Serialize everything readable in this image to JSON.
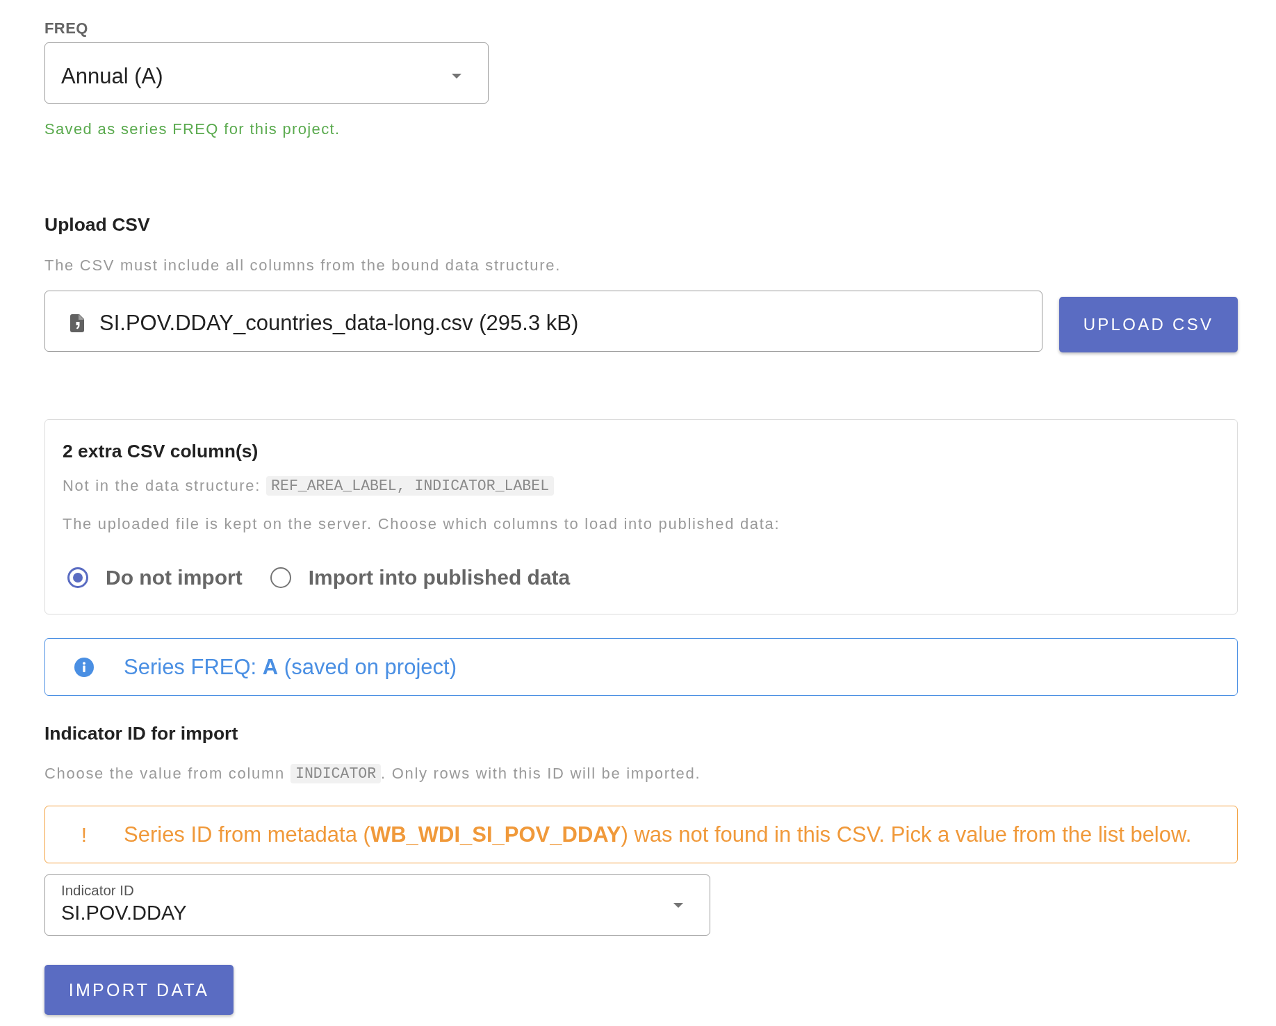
{
  "freq_field": {
    "label": "FREQ",
    "value": "Annual (A)",
    "helper": "Saved as series FREQ for this project."
  },
  "upload_csv": {
    "heading": "Upload CSV",
    "description": "The CSV must include all columns from the bound data structure.",
    "file": "SI.POV.DDAY_countries_data-long.csv (295.3 kB)",
    "button": "UPLOAD CSV"
  },
  "extra_columns": {
    "heading": "2 extra CSV column(s)",
    "missing_label": "Not in the data structure:",
    "missing_columns": "REF_AREA_LABEL, INDICATOR_LABEL",
    "note": "The uploaded file is kept on the server. Choose which columns to load into published data:",
    "options": [
      {
        "label": "Do not import",
        "selected": true
      },
      {
        "label": "Import into published data",
        "selected": false
      }
    ]
  },
  "freq_notice": {
    "kind": "info",
    "text": "Series FREQ: **A** (saved on project)"
  },
  "indicator_id": {
    "heading": "Indicator ID for import",
    "description_before": "Choose the value from column",
    "column": "INDICATOR",
    "description_after": ". Only rows with this ID will be imported.",
    "warning": {
      "kind": "warning",
      "icon": "!",
      "text": "Series ID from metadata (**WB_WDI_SI_POV_DDAY**) was not found in this CSV. Pick a value from the list below."
    },
    "select": {
      "label": "Indicator ID",
      "value": "SI.POV.DDAY"
    },
    "button": "IMPORT DATA"
  }
}
